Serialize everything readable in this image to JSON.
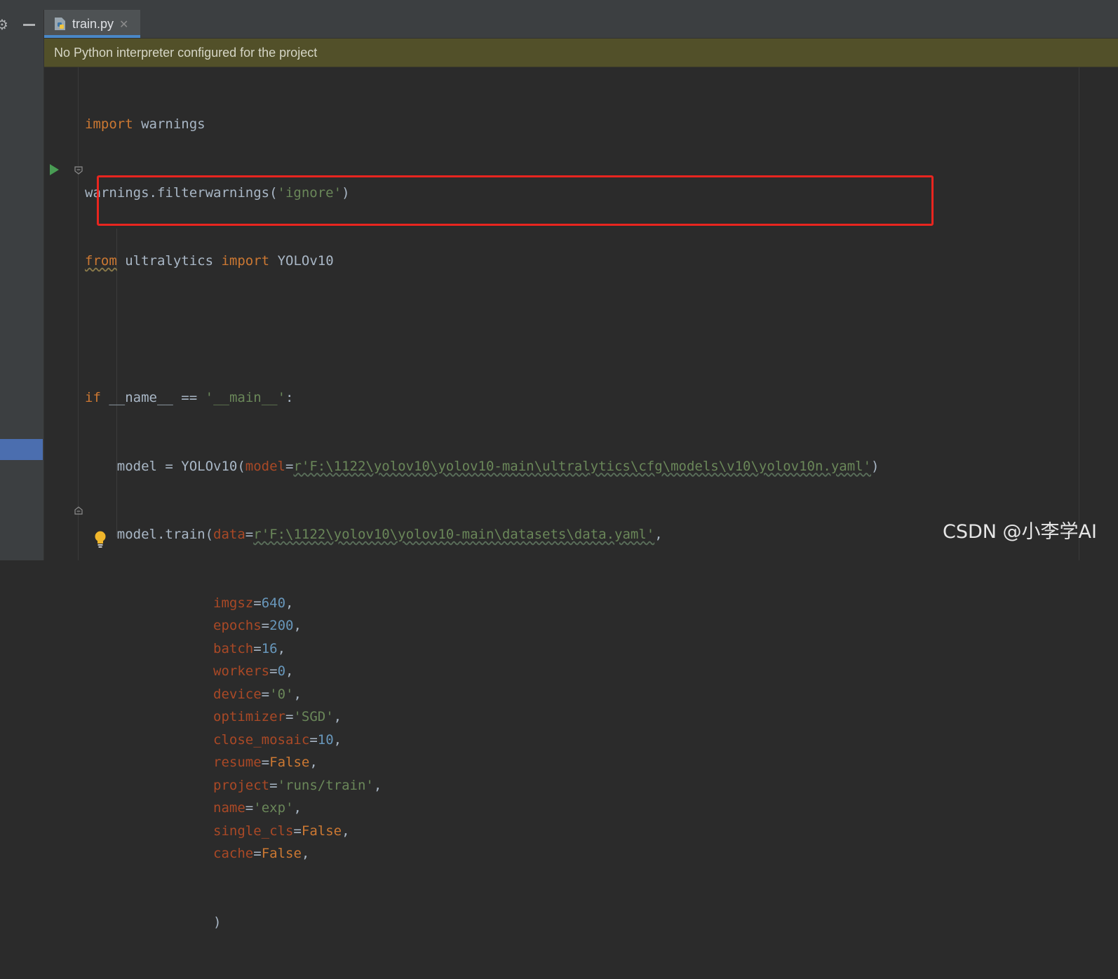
{
  "tab": {
    "label": "train.py",
    "close": "✕"
  },
  "banner": {
    "text": "No Python interpreter configured for the project"
  },
  "code": {
    "line1": {
      "kw": "import",
      "rest": " warnings"
    },
    "line2": {
      "pre": "warnings.filterwarnings(",
      "str": "'ignore'",
      "post": ")"
    },
    "line3": {
      "kw1": "from",
      "mid": " ultralytics ",
      "kw2": "import",
      "rest": " YOLOv10"
    },
    "line5": {
      "kw": "if",
      "sp1": " ",
      "dunder1": "__name__",
      "op": " == ",
      "str": "'__main__'",
      "post": ":"
    },
    "line6": {
      "pre": "    model = YOLOv10(",
      "param": "model",
      "eq": "=",
      "str": "r'F:\\1122\\yolov10\\yolov10-main\\ultralytics\\cfg\\models\\v10\\yolov10n.yaml'",
      "post": ")"
    },
    "line7": {
      "pre": "    model.train(",
      "param": "data",
      "eq": "=",
      "str": "r'F:\\1122\\yolov10\\yolov10-main\\datasets\\data.yaml'",
      "post": ","
    },
    "args": [
      {
        "param": "imgsz",
        "eq": "=",
        "val": "640",
        "post": ","
      },
      {
        "param": "epochs",
        "eq": "=",
        "val": "200",
        "post": ","
      },
      {
        "param": "batch",
        "eq": "=",
        "val": "16",
        "post": ","
      },
      {
        "param": "workers",
        "eq": "=",
        "val": "0",
        "post": ","
      },
      {
        "param": "device",
        "eq": "=",
        "val": "'0'",
        "post": ","
      },
      {
        "param": "optimizer",
        "eq": "=",
        "val": "'SGD'",
        "post": ","
      },
      {
        "param": "close_mosaic",
        "eq": "=",
        "val": "10",
        "post": ","
      },
      {
        "param": "resume",
        "eq": "=",
        "val": "False",
        "post": ","
      },
      {
        "param": "project",
        "eq": "=",
        "val": "'runs/train'",
        "post": ","
      },
      {
        "param": "name",
        "eq": "=",
        "val": "'exp'",
        "post": ","
      },
      {
        "param": "single_cls",
        "eq": "=",
        "val": "False",
        "post": ","
      },
      {
        "param": "cache",
        "eq": "=",
        "val": "False",
        "post": ","
      }
    ],
    "closing": ")",
    "arg_indent": "                "
  },
  "watermark": "CSDN @小李学AI",
  "colors": {
    "keyword": "#cc7832",
    "string": "#6a8759",
    "number": "#6897bb",
    "param": "#aa4926",
    "default_text": "#a9b7c6",
    "highlight_box": "#e8251f"
  },
  "icons": [
    "gear-icon",
    "minimize-icon",
    "python-file-icon",
    "close-icon",
    "run-icon",
    "fold-icon",
    "lightbulb-icon"
  ]
}
